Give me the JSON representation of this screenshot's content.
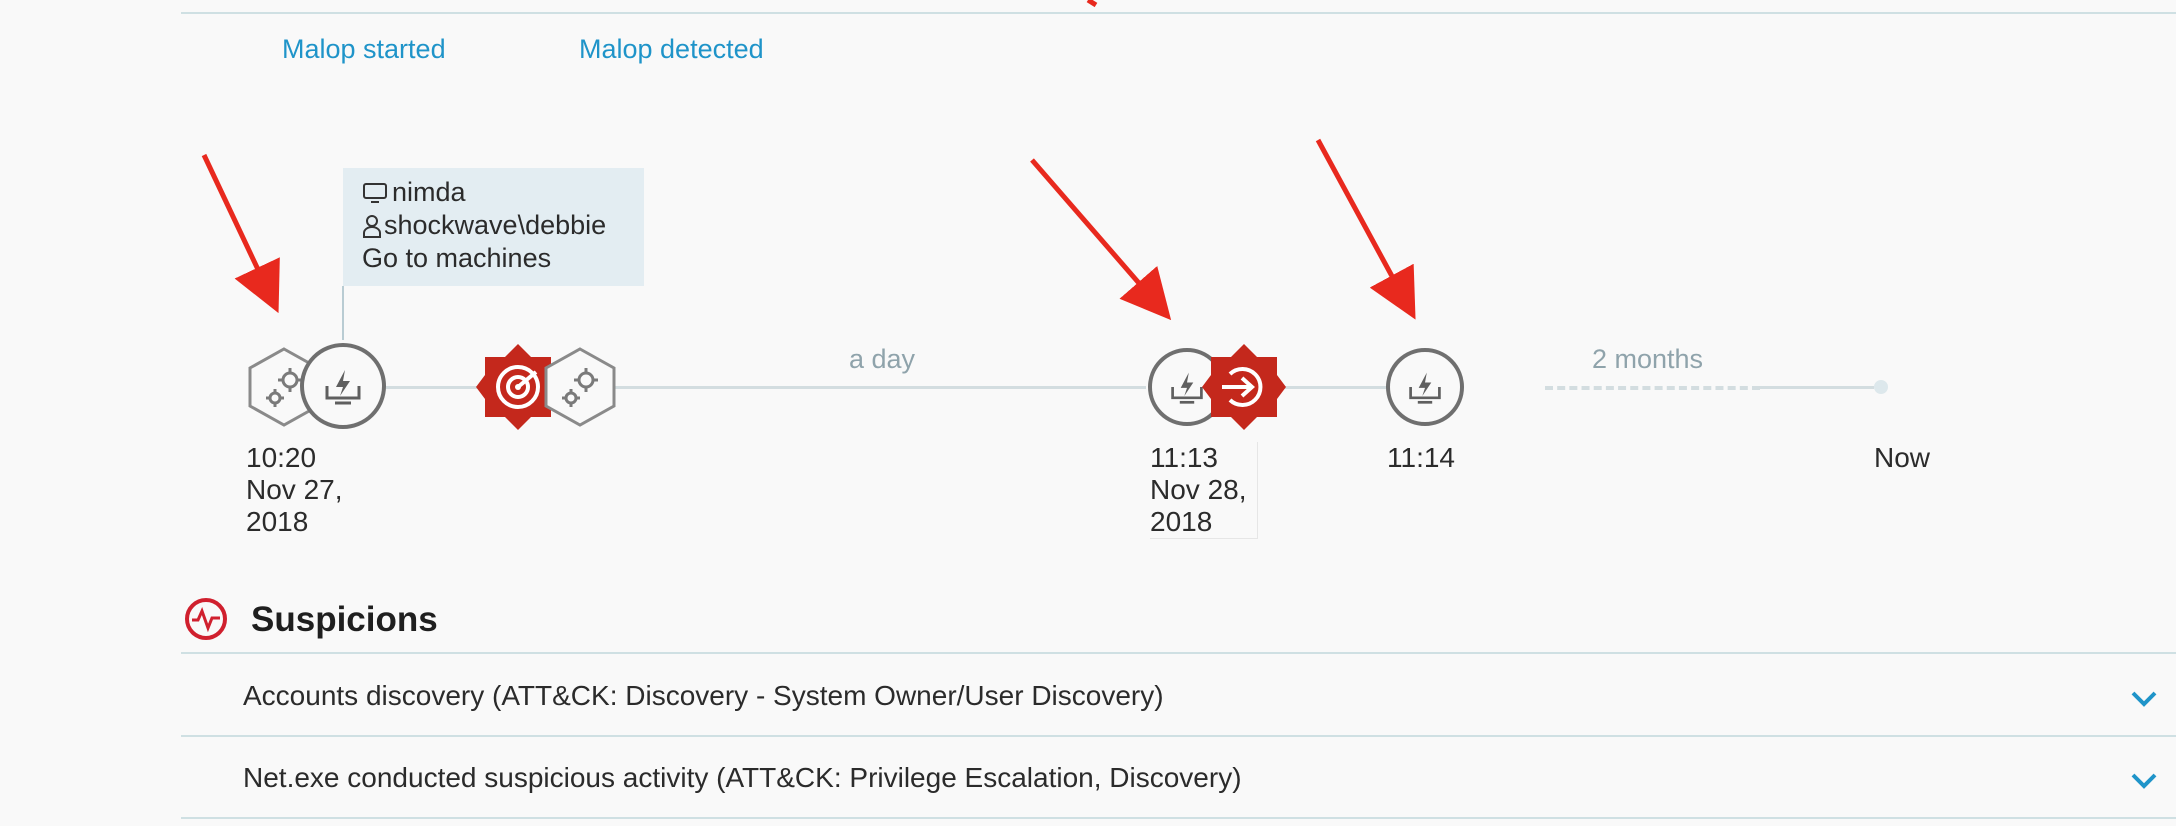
{
  "header": {
    "link_started": "Malop started",
    "link_detected": "Malop detected"
  },
  "timeline": {
    "gap_1": "a day",
    "gap_2": "2 months",
    "node_1": {
      "time": "10:20",
      "date_line1": "Nov 27,",
      "date_line2": "2018"
    },
    "node_2": {
      "time": "11:13",
      "date_line1": "Nov 28,",
      "date_line2": "2018"
    },
    "node_3": {
      "time": "11:14"
    },
    "end_label": "Now"
  },
  "tooltip": {
    "machine": "nimda",
    "user": "shockwave\\debbie",
    "link": "Go to machines"
  },
  "suspicions": {
    "title": "Suspicions",
    "items": [
      {
        "label": "Accounts discovery (ATT&CK: Discovery - System Owner/User Discovery)"
      },
      {
        "label": "Net.exe conducted suspicious activity (ATT&CK: Privilege Escalation, Discovery)"
      }
    ]
  },
  "colors": {
    "accent_link": "#1f94c9",
    "malop_red": "#c4281c",
    "annotation_arrow": "#e8291e",
    "track": "#d3dde0"
  },
  "icons": [
    "gears-icon",
    "machine-lightning-icon",
    "radar-icon",
    "logon-icon",
    "pulse-icon",
    "chevron-down-icon",
    "monitor-icon",
    "user-icon"
  ]
}
